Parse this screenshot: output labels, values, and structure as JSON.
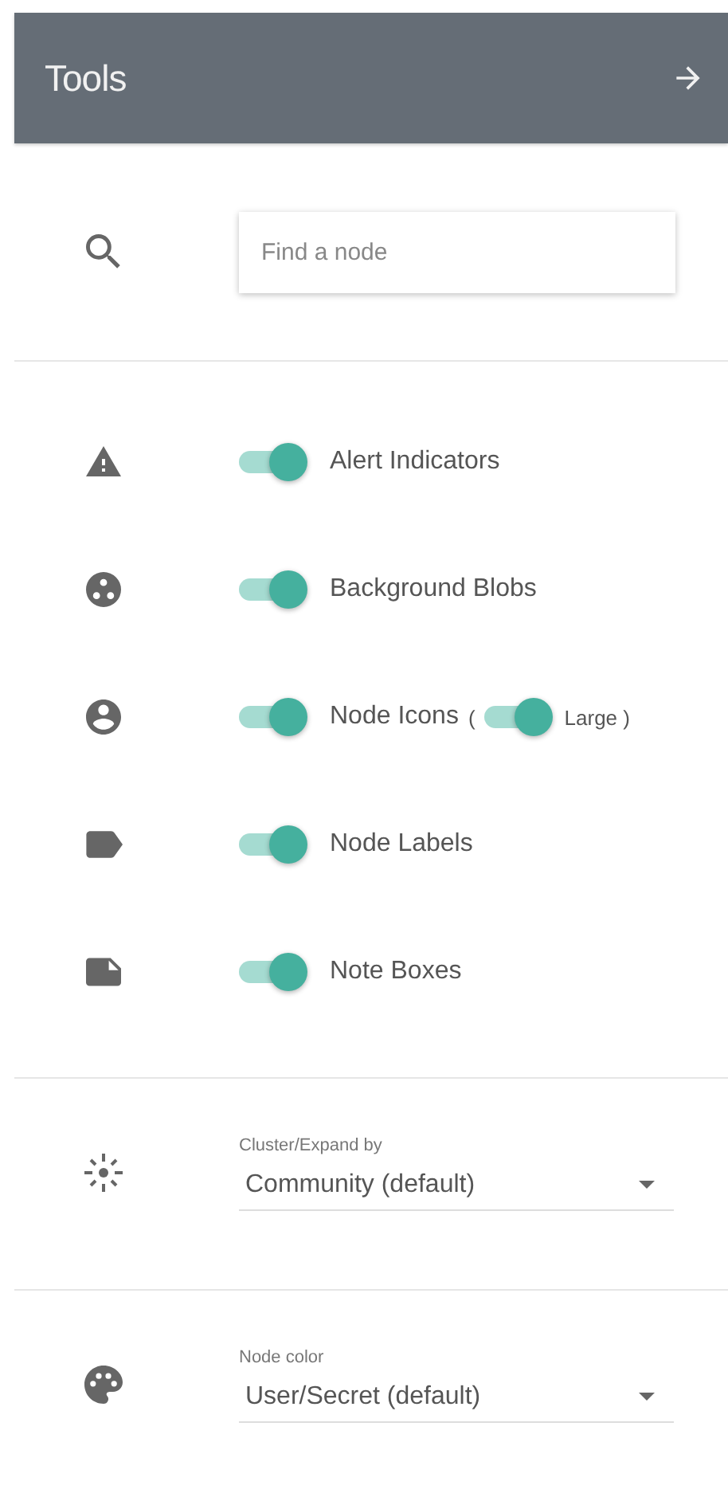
{
  "header": {
    "title": "Tools"
  },
  "search": {
    "placeholder": "Find a node"
  },
  "toggles": [
    {
      "label": "Alert Indicators",
      "on": true
    },
    {
      "label": "Background Blobs",
      "on": true
    },
    {
      "label": "Node Icons",
      "on": true,
      "sub": {
        "open": "(",
        "label": "Large",
        "close": ")",
        "on": true
      }
    },
    {
      "label": "Node Labels",
      "on": true
    },
    {
      "label": "Note Boxes",
      "on": true
    }
  ],
  "selects": [
    {
      "label": "Cluster/Expand by",
      "value": "Community (default)"
    },
    {
      "label": "Node color",
      "value": "User/Secret (default)"
    }
  ]
}
